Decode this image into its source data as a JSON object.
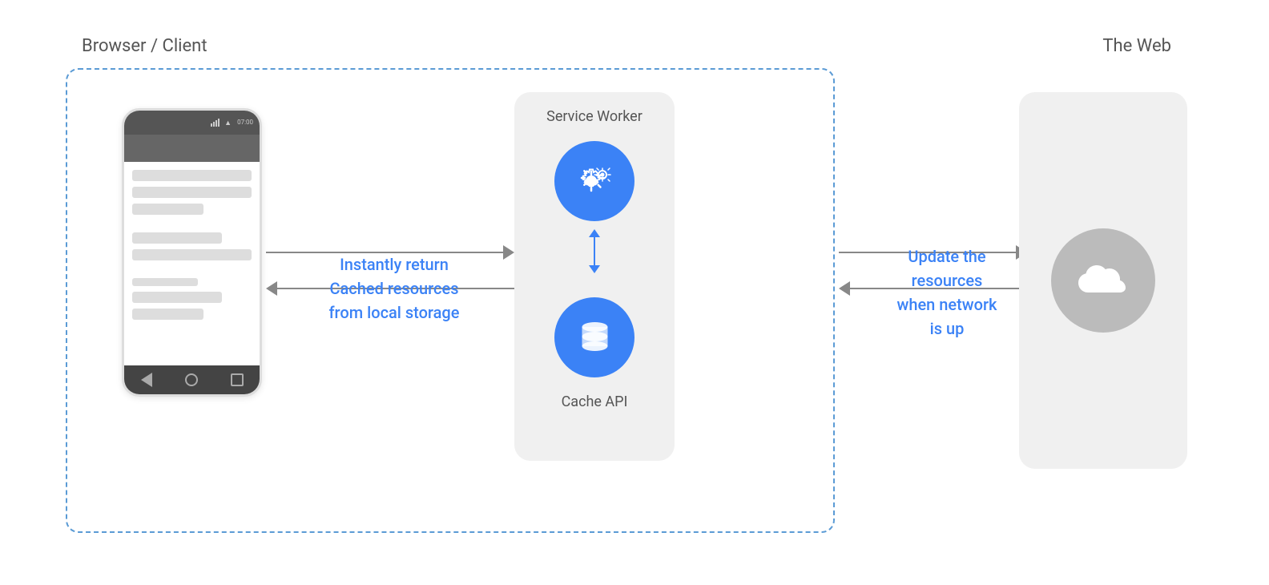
{
  "labels": {
    "browser_client": "Browser / Client",
    "the_web": "The Web",
    "service_worker": "Service Worker",
    "cache_api": "Cache API",
    "instantly_return": "Instantly return",
    "cached_resources": "Cached resources",
    "from_local_storage": "from local storage",
    "update_the": "Update the",
    "resources": "resources",
    "when_network": "when network",
    "is_up": "is up"
  },
  "colors": {
    "blue": "#3b82f6",
    "gray_text": "#555555",
    "dashed_border": "#5b9bd5",
    "light_bg": "#f0f0f0",
    "arrow_gray": "#888888",
    "cloud_gray": "#bbbbbb",
    "content_gray": "#dddddd",
    "phone_dark": "#555555",
    "phone_darker": "#444444"
  },
  "icons": {
    "gear": "gear-icon",
    "database": "database-icon",
    "cloud": "cloud-icon"
  }
}
